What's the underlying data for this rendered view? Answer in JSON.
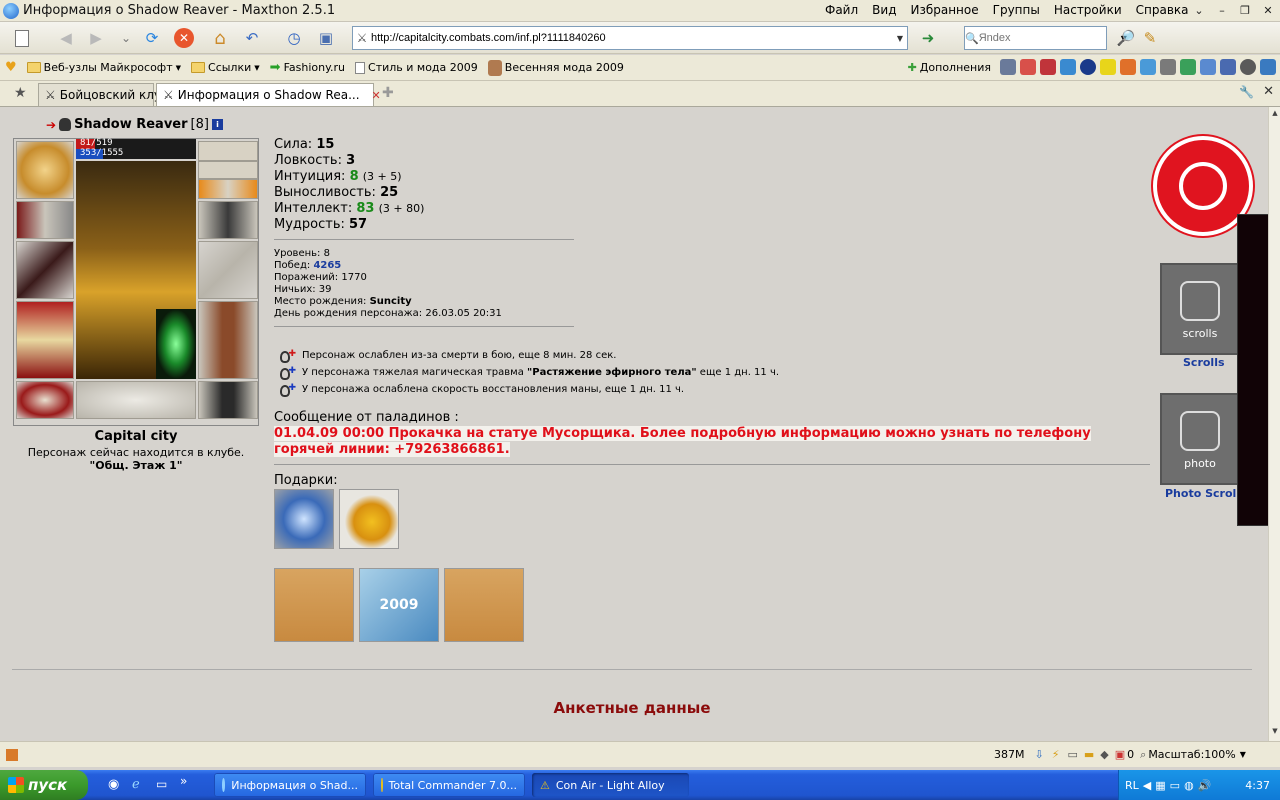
{
  "window": {
    "title": "Информация о Shadow Reaver - Maxthon 2.5.1",
    "menus": [
      "Файл",
      "Вид",
      "Избранное",
      "Группы",
      "Настройки",
      "Справка"
    ]
  },
  "toolbar": {
    "address": "http://capitalcity.combats.com/inf.pl?1111840260",
    "search_placeholder": "Яndex"
  },
  "links": [
    "Веб-узлы Майкрософт",
    "Ссылки",
    "Fashiony.ru",
    "Стиль и мода 2009",
    "Весенняя мода 2009"
  ],
  "links_tools": {
    "addons": "Дополнения"
  },
  "tabs": [
    {
      "label": "Бойцовский клуб",
      "active": false
    },
    {
      "label": "Информация о Shadow Rea...",
      "active": true
    }
  ],
  "character": {
    "name": "Shadow Reaver",
    "level": "[8]",
    "hp": "81/519",
    "hp_fraction": 0.156,
    "mana": "353/1555",
    "mana_fraction": 0.227,
    "city": "Capital city",
    "location_line": "Персонаж сейчас находится в клубе.",
    "location": "\"Общ. Этаж 1\""
  },
  "stats": [
    {
      "label": "Сила:",
      "value": "15",
      "extra": "",
      "green": false
    },
    {
      "label": "Ловкость:",
      "value": "3",
      "extra": "",
      "green": false
    },
    {
      "label": "Интуиция:",
      "value": "8",
      "extra": "(3 + 5)",
      "green": true
    },
    {
      "label": "Выносливость:",
      "value": "25",
      "extra": "",
      "green": false
    },
    {
      "label": "Интеллект:",
      "value": "83",
      "extra": "(3 + 80)",
      "green": true
    },
    {
      "label": "Мудрость:",
      "value": "57",
      "extra": "",
      "green": false
    }
  ],
  "info": {
    "level": "Уровень: 8",
    "wins_label": "Побед:",
    "wins": "4265",
    "losses": "Поражений: 1770",
    "draws": "Ничьих: 39",
    "birthplace_label": "Место рождения:",
    "birthplace": "Suncity",
    "birthday": "День рождения персонажа: 26.03.05 20:31"
  },
  "effects": {
    "e1": "Персонаж ослаблен из-за смерти в бою, еще 8 мин. 28 сек.",
    "e2_pre": "У персонажа тяжелая магическая травма",
    "e2_bold": "\"Растяжение эфирного тела\"",
    "e2_post": "еще 1 дн. 11 ч.",
    "e3": "У персонажа ослаблена скорость восстановления маны, еще 1 дн. 11 ч."
  },
  "paladins": {
    "header": "Сообщение от паладинов :",
    "message": "01.04.09 00:00 Прокачка на статуе Мусорщика. Более подробную информацию можно узнать по телефону горячей линии: +79263866861."
  },
  "gifts": {
    "header": "Подарки:",
    "banner": "2009"
  },
  "anketa": "Анкетные данные",
  "side": {
    "scrolls_label": "scrolls",
    "scrolls_title": "Scrolls",
    "photo_label": "photo",
    "photo_title": "Photo Scrolls"
  },
  "statusbar": {
    "memory": "387M",
    "count": "0",
    "zoom": "Масштаб:100%"
  },
  "taskbar": {
    "start": "пуск",
    "tasks": [
      "Информация о Shad...",
      "Total Commander 7.0...",
      "Con Air - Light Alloy"
    ],
    "lang": "RL",
    "clock": "4:37"
  }
}
